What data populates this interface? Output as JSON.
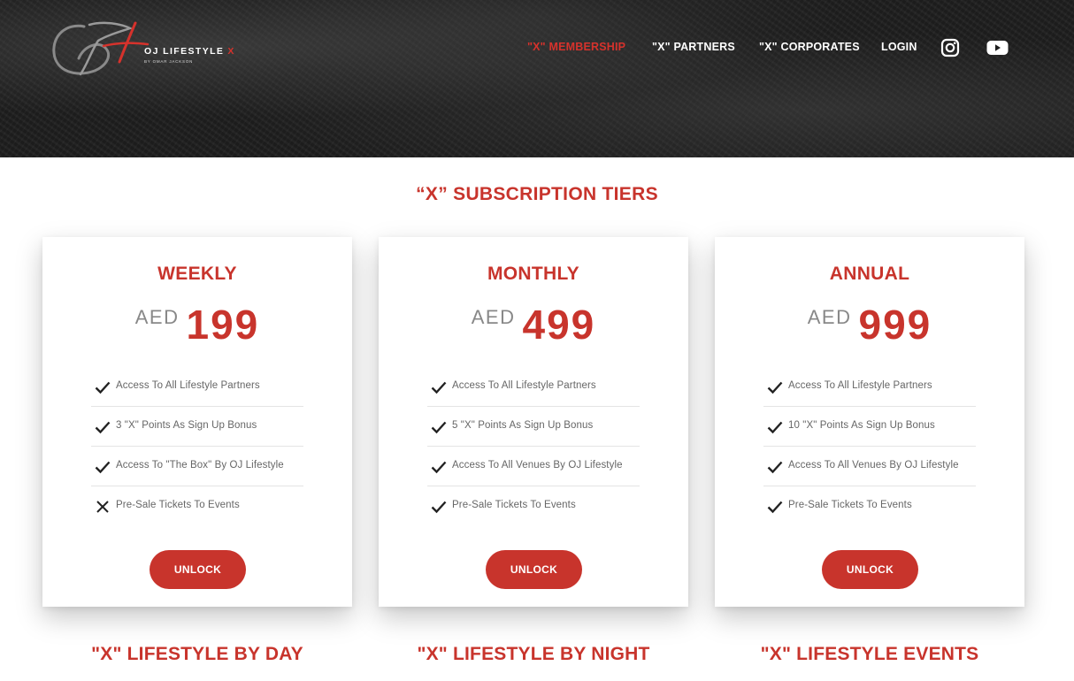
{
  "header": {
    "logo": {
      "title": "OJ LIFESTYLE",
      "x_mark": "X",
      "byline": "BY OMAR JACKSON"
    },
    "nav": [
      {
        "label": "\"X\" MEMBERSHIP",
        "active": true
      },
      {
        "label": "\"X\" PARTNERS",
        "active": false
      },
      {
        "label": "\"X\" CORPORATES",
        "active": false
      },
      {
        "label": "LOGIN",
        "active": false
      }
    ],
    "social": [
      "instagram-icon",
      "youtube-icon"
    ]
  },
  "section": {
    "title": "“X” SUBSCRIPTION TIERS"
  },
  "tiers": [
    {
      "name": "WEEKLY",
      "currency": "AED",
      "price": "199",
      "features": [
        {
          "text": "Access To All Lifestyle Partners",
          "included": true
        },
        {
          "text": "3 \"X\" Points As Sign Up Bonus",
          "included": true
        },
        {
          "text": "Access To \"The Box\" By OJ Lifestyle",
          "included": true
        },
        {
          "text": "Pre-Sale Tickets To Events",
          "included": false
        }
      ],
      "button": "UNLOCK"
    },
    {
      "name": "MONTHLY",
      "currency": "AED",
      "price": "499",
      "features": [
        {
          "text": "Access To All Lifestyle Partners",
          "included": true
        },
        {
          "text": "5 \"X\" Points As Sign Up Bonus",
          "included": true
        },
        {
          "text": "Access To All Venues By OJ Lifestyle",
          "included": true
        },
        {
          "text": "Pre-Sale Tickets To Events",
          "included": true
        }
      ],
      "button": "UNLOCK"
    },
    {
      "name": "ANNUAL",
      "currency": "AED",
      "price": "999",
      "features": [
        {
          "text": "Access To All Lifestyle Partners",
          "included": true
        },
        {
          "text": "10 \"X\" Points As Sign Up Bonus",
          "included": true
        },
        {
          "text": "Access To All Venues By OJ Lifestyle",
          "included": true
        },
        {
          "text": "Pre-Sale Tickets To Events",
          "included": true
        }
      ],
      "button": "UNLOCK"
    }
  ],
  "bottom_headings": [
    "\"X\" LIFESTYLE BY DAY",
    "\"X\" LIFESTYLE BY NIGHT",
    "\"X\" LIFESTYLE EVENTS"
  ],
  "colors": {
    "accent": "#c8342c",
    "header_bg": "#1e1e1e",
    "text_muted": "#666666"
  }
}
